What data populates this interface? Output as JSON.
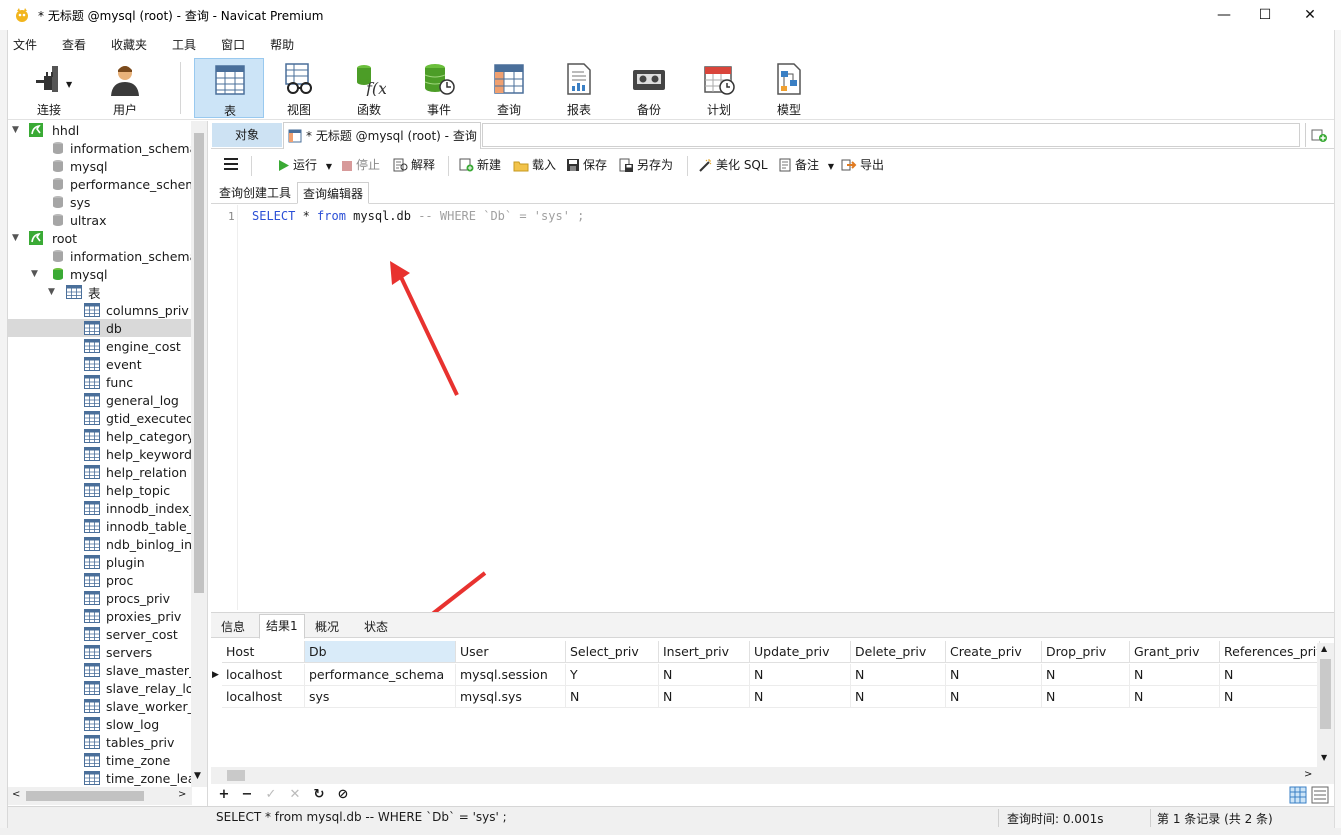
{
  "window": {
    "title": "* 无标题 @mysql (root) - 查询 - Navicat Premium",
    "minimize_glyph": "—",
    "maximize_glyph": "☐",
    "close_glyph": "✕"
  },
  "menu": [
    "文件",
    "查看",
    "收藏夹",
    "工具",
    "窗口",
    "帮助"
  ],
  "toolbar": [
    {
      "label": "连接",
      "icon": "plug-icon"
    },
    {
      "label": "用户",
      "icon": "user-icon"
    },
    {
      "label": "表",
      "icon": "table-icon",
      "active": true
    },
    {
      "label": "视图",
      "icon": "view-glasses-icon"
    },
    {
      "label": "函数",
      "icon": "function-icon"
    },
    {
      "label": "事件",
      "icon": "event-clock-icon"
    },
    {
      "label": "查询",
      "icon": "query-grid-icon"
    },
    {
      "label": "报表",
      "icon": "report-icon"
    },
    {
      "label": "备份",
      "icon": "backup-tape-icon"
    },
    {
      "label": "计划",
      "icon": "calendar-icon"
    },
    {
      "label": "模型",
      "icon": "model-icon"
    }
  ],
  "tree": [
    {
      "label": "hhdl",
      "level": 0,
      "type": "connection",
      "expanded": true
    },
    {
      "label": "information_schema",
      "level": 1,
      "type": "db"
    },
    {
      "label": "mysql",
      "level": 1,
      "type": "db"
    },
    {
      "label": "performance_schema",
      "level": 1,
      "type": "db"
    },
    {
      "label": "sys",
      "level": 1,
      "type": "db"
    },
    {
      "label": "ultrax",
      "level": 1,
      "type": "db"
    },
    {
      "label": "root",
      "level": 0,
      "type": "connection",
      "expanded": true
    },
    {
      "label": "information_schema",
      "level": 1,
      "type": "db"
    },
    {
      "label": "mysql",
      "level": 1,
      "type": "db-open",
      "expanded": true
    },
    {
      "label": "表",
      "level": 2,
      "type": "folder",
      "expanded": true
    },
    {
      "label": "columns_priv",
      "level": 3,
      "type": "table"
    },
    {
      "label": "db",
      "level": 3,
      "type": "table",
      "selected": true
    },
    {
      "label": "engine_cost",
      "level": 3,
      "type": "table"
    },
    {
      "label": "event",
      "level": 3,
      "type": "table"
    },
    {
      "label": "func",
      "level": 3,
      "type": "table"
    },
    {
      "label": "general_log",
      "level": 3,
      "type": "table"
    },
    {
      "label": "gtid_executed",
      "level": 3,
      "type": "table"
    },
    {
      "label": "help_category",
      "level": 3,
      "type": "table"
    },
    {
      "label": "help_keyword",
      "level": 3,
      "type": "table"
    },
    {
      "label": "help_relation",
      "level": 3,
      "type": "table"
    },
    {
      "label": "help_topic",
      "level": 3,
      "type": "table"
    },
    {
      "label": "innodb_index_s",
      "level": 3,
      "type": "table"
    },
    {
      "label": "innodb_table_s",
      "level": 3,
      "type": "table"
    },
    {
      "label": "ndb_binlog_inc",
      "level": 3,
      "type": "table"
    },
    {
      "label": "plugin",
      "level": 3,
      "type": "table"
    },
    {
      "label": "proc",
      "level": 3,
      "type": "table"
    },
    {
      "label": "procs_priv",
      "level": 3,
      "type": "table"
    },
    {
      "label": "proxies_priv",
      "level": 3,
      "type": "table"
    },
    {
      "label": "server_cost",
      "level": 3,
      "type": "table"
    },
    {
      "label": "servers",
      "level": 3,
      "type": "table"
    },
    {
      "label": "slave_master_in",
      "level": 3,
      "type": "table"
    },
    {
      "label": "slave_relay_log",
      "level": 3,
      "type": "table"
    },
    {
      "label": "slave_worker_in",
      "level": 3,
      "type": "table"
    },
    {
      "label": "slow_log",
      "level": 3,
      "type": "table"
    },
    {
      "label": "tables_priv",
      "level": 3,
      "type": "table"
    },
    {
      "label": "time_zone",
      "level": 3,
      "type": "table"
    },
    {
      "label": "time_zone_leap",
      "level": 3,
      "type": "table"
    }
  ],
  "tabs": {
    "objects": "对象",
    "query": "* 无标题 @mysql (root) - 查询"
  },
  "query_toolbar": {
    "run": "运行",
    "stop": "停止",
    "explain": "解释",
    "new": "新建",
    "load": "载入",
    "save": "保存",
    "save_as": "另存为",
    "beautify": "美化 SQL",
    "comment": "备注",
    "export": "导出"
  },
  "sub_tabs": [
    "查询创建工具",
    "查询编辑器"
  ],
  "editor": {
    "line_number": "1",
    "kw_select": "SELECT",
    "star": " * ",
    "kw_from": "from",
    "table": " mysql.db ",
    "comment": "-- WHERE `Db` = 'sys' ;"
  },
  "result_tabs": [
    "信息",
    "结果1",
    "概况",
    "状态"
  ],
  "grid": {
    "columns": [
      "Host",
      "Db",
      "User",
      "Select_priv",
      "Insert_priv",
      "Update_priv",
      "Delete_priv",
      "Create_priv",
      "Drop_priv",
      "Grant_priv",
      "References_priv"
    ],
    "rows": [
      [
        "localhost",
        "performance_schema",
        "mysql.session",
        "Y",
        "N",
        "N",
        "N",
        "N",
        "N",
        "N",
        "N"
      ],
      [
        "localhost",
        "sys",
        "mysql.sys",
        "N",
        "N",
        "N",
        "N",
        "N",
        "N",
        "N",
        "N"
      ]
    ],
    "row_marker": "▶"
  },
  "nav_buttons": [
    "+",
    "−",
    "✓",
    "✕",
    "↻",
    "⊘"
  ],
  "status": {
    "sql": "SELECT * from mysql.db -- WHERE `Db` = 'sys' ;",
    "query_time": "查询时间: 0.001s",
    "records": "第 1 条记录 (共 2 条)"
  },
  "colors": {
    "accent": "#cce4f7",
    "keyword": "#2b4fd6",
    "comment": "#a0a0a0",
    "arrow": "#e8322f",
    "db_green": "#3aaa35"
  }
}
